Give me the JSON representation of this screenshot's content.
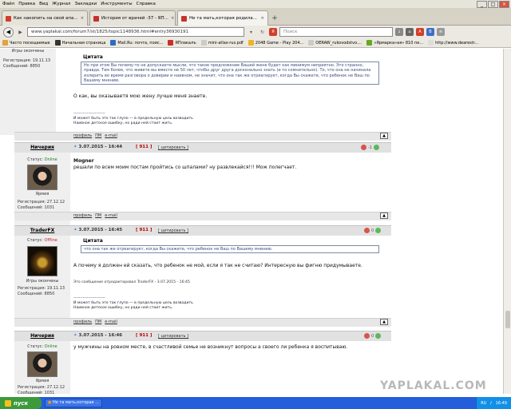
{
  "menubar": [
    "Файл",
    "Правка",
    "Вид",
    "Журнал",
    "Закладки",
    "Инструменты",
    "Справка"
  ],
  "tabs": [
    {
      "label": "Как накопить на свой апа...",
      "color": "#d33d2b"
    },
    {
      "label": "История от врачей -37 - ЯП...",
      "color": "#c9302c"
    },
    {
      "label": "Не та мать,которая родила...",
      "color": "#c9302c"
    }
  ],
  "nav": {
    "url": "www.yaplakal.com/forum7/st/1825/topic1148936.html#entry36930191",
    "search_placeholder": "Поиск"
  },
  "bookmarks": [
    "Часто посещаемые",
    "Начальная страница",
    "Mail.Ru: почта, поис...",
    "ЯПлакалъ",
    "mini-atlas-rus.pdf",
    "2048 Game - Play 204...",
    "OERAW_rukovodstvo....",
    "«Ярмарка»ая» 810 пе...",
    "http://www.dearestr..."
  ],
  "posts": {
    "p0": {
      "rank": "Игры окончены",
      "meta": "Регистрация: 19.11.13\nСообщений: 8850",
      "quote_title": "Цитата",
      "quote": "Но при этом Вы почему-то не допускаете мысли, что такое предложение Вашей жене будет как минимум неприятно. Это странно, правда. Тем более, что живете вы вместе не 50 лет, чтобы друг друга досконально знать (и то сомнительно). То, что она не начинала излерить во время разговора о доверии и наивном, не значит, что она так же отреагирует, когда Вы скажете, что ребенок не Ваш по Вашему мнению.",
      "text": "О как, вы оказываетя мою жену лучше меня знаете.",
      "signature": "------------------------\nИ может быть это так глупо — в предельную цель возводить\nНаивное детское ошибку, но ради ней стоит жить."
    },
    "p1": {
      "name": "Ничерия",
      "date": "3.07.2015 - 16:44",
      "num": "911",
      "cite": "цитировать",
      "vote": "-1",
      "status_label": "Статус:",
      "status": "Online",
      "rank": "Ярмия",
      "meta": "Регистрация: 27.12.12\nСообщений: 1031",
      "text_bold": "Mogner",
      "text": "решали по всем моим постам пройтись со шпалами? ну развлекайся!!! Мож полегчает."
    },
    "p2": {
      "name": "TraderFX",
      "date": "3.07.2015 - 16:45",
      "num": "911",
      "cite": "цитировать",
      "vote": "0",
      "status_label": "Статус:",
      "status": "Offline",
      "rank": "Игры окончены",
      "meta": "Регистрация: 19.11.13\nСообщений: 8850",
      "quote_title": "Цитата",
      "quote": "что она так же отреагирует, когда Вы скажете, что ребенок не Ваш по Вашему мнению.",
      "text": "А почему я должен ей сказать, что ребенок не мой, если я так не считаю? Интересную вы фигню придумываете.",
      "edit": "Это сообщение отредактировал TraderFX - 3.07.2015 - 16:45",
      "signature": "------------------------\nИ может быть это так глупо — в предельную цель возводить\nНаивное детское ошибку, но ради ней стоит жить."
    },
    "p3": {
      "name": "Ничерия",
      "date": "3.07.2015 - 16:46",
      "num": "911",
      "cite": "цитировать",
      "vote": "0",
      "status_label": "Статус:",
      "status": "Online",
      "rank": "Ярмия",
      "meta": "Регистрация: 27.12.12\nСообщений: 1031",
      "text": "у мужчины на ровном месте, в счастливой семье не возникнут вопросы а своего ли ребенка я воспитываю."
    }
  },
  "footer_links": [
    "профиль",
    "ПМ",
    "e-mail"
  ],
  "watermark": "YAPLAKAL.COM",
  "taskbar": {
    "start": "пуск",
    "items": [
      "Не та мать,которая ..."
    ],
    "lang": "RU",
    "clock": "16:49"
  },
  "colors": {
    "quote_border": "#7b8ba3",
    "online": "#1d7e1d",
    "offline": "#cc2233",
    "taskbar": "#245edb"
  }
}
